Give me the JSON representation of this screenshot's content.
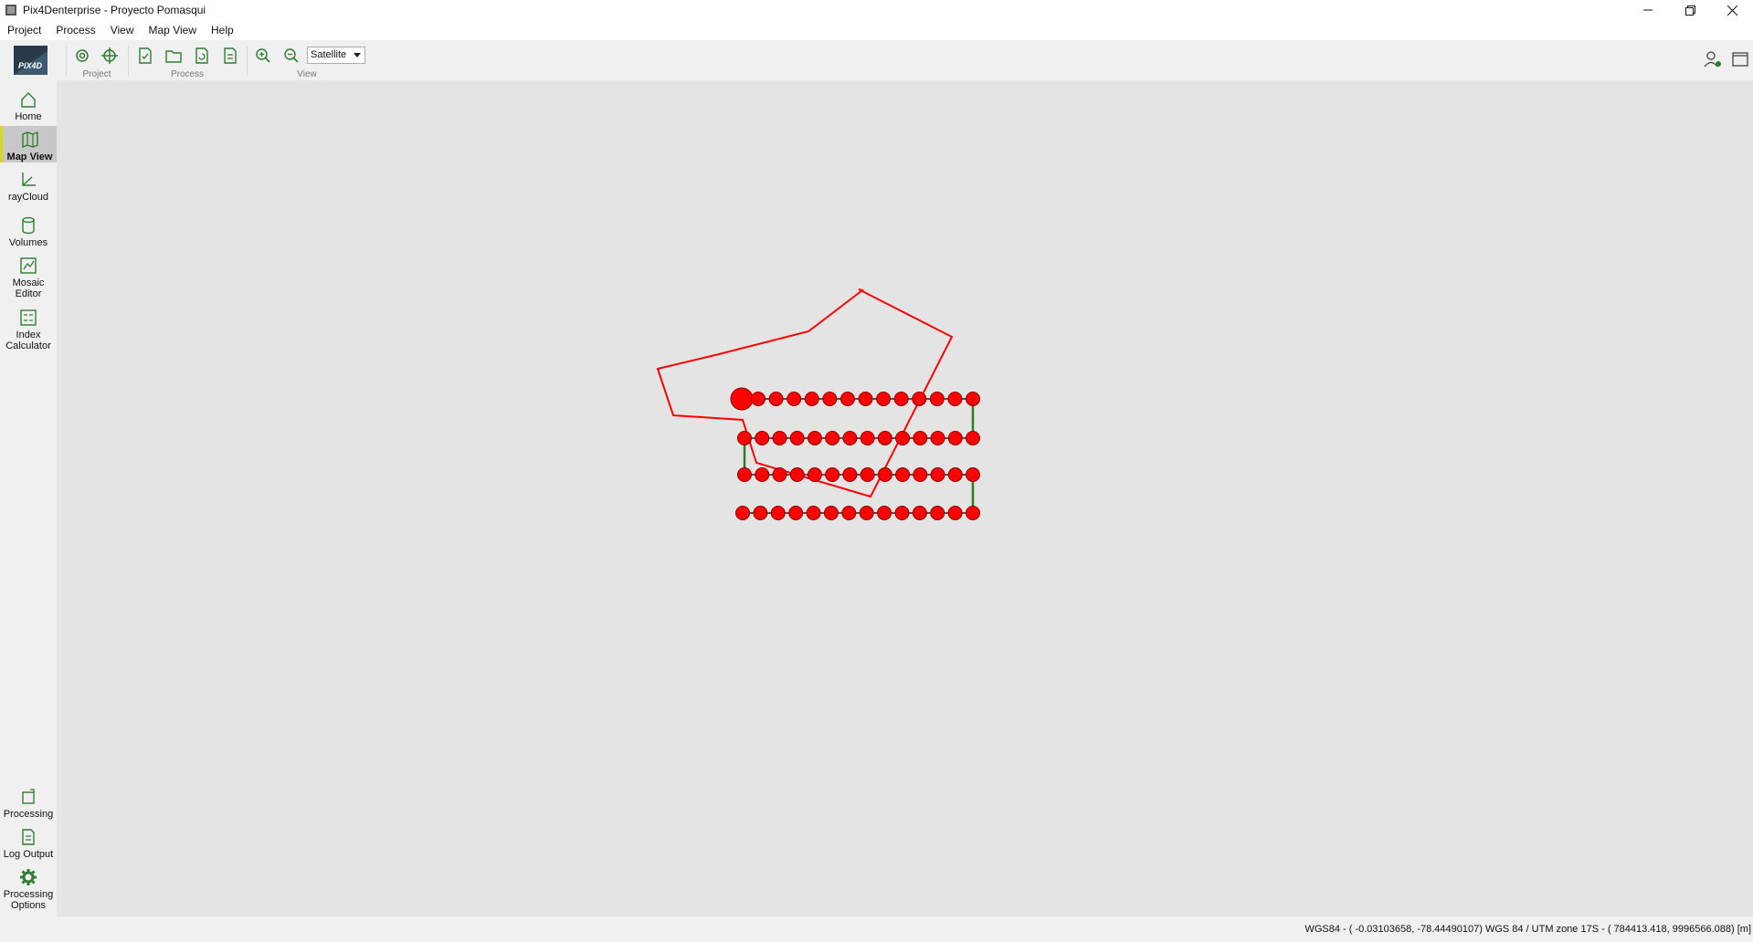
{
  "window": {
    "title": "Pix4Denterprise - Proyecto Pomasqui"
  },
  "menu": [
    "Project",
    "Process",
    "View",
    "Map View",
    "Help"
  ],
  "toolbar": {
    "groups": {
      "project": "Project",
      "process": "Process",
      "view": "View"
    },
    "basemap_selected": "Satellite",
    "logo_text": "Pix4D"
  },
  "sidebar": {
    "home": "Home",
    "map_view": "Map View",
    "raycloud": "rayCloud",
    "volumes": "Volumes",
    "mosaic_editor": [
      "Mosaic",
      "Editor"
    ],
    "index_calculator": [
      "Index",
      "Calculator"
    ],
    "processing": "Processing",
    "log_output": "Log Output",
    "processing_options": [
      "Processing",
      "Options"
    ]
  },
  "map": {
    "flight_plan": {
      "lines": 4,
      "images_per_line": [
        13,
        14,
        14,
        14
      ],
      "image_color": "#ff0000",
      "connector_color": "#2e7d1e",
      "area_color": "#ff0000"
    }
  },
  "statusbar": {
    "coordinates": "WGS84 - ( -0.03103658,  -78.44490107)  WGS 84 / UTM zone 17S - (   784413.418,   9996566.088) [m]"
  },
  "colors": {
    "active_accent": "#d8d820",
    "map_bg": "#e4e4e4",
    "icon_green": "#2e7d32"
  }
}
